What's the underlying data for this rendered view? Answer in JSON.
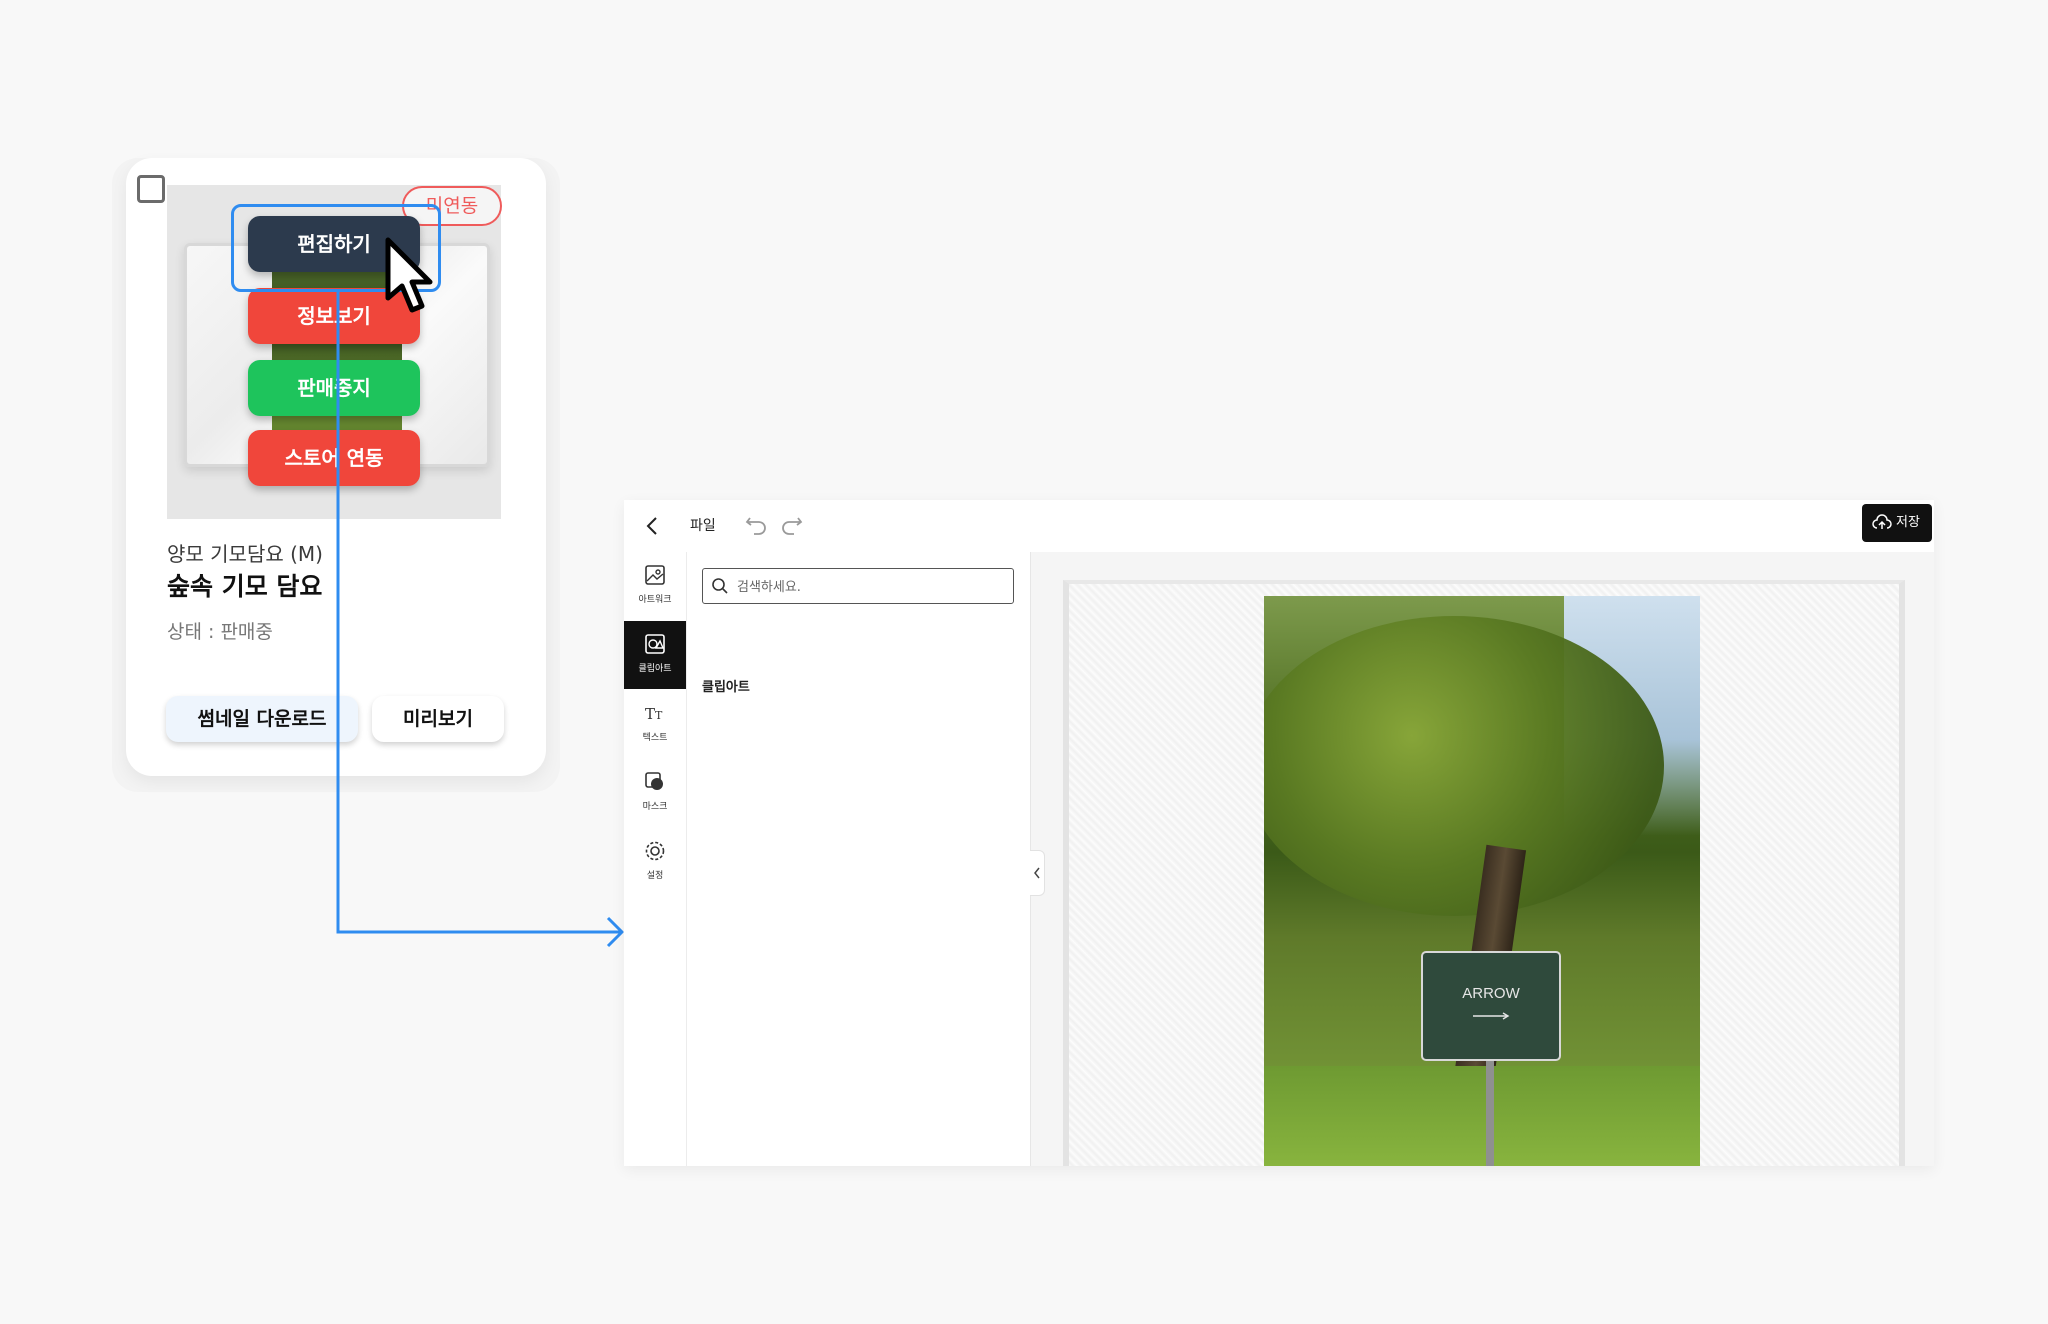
{
  "product_card": {
    "status_badge": "미연동",
    "menu": {
      "edit": "편집하기",
      "info": "정보보기",
      "stop_sale": "판매중지",
      "store_link": "스토어 연동"
    },
    "subtitle": "양모 기모담요 (M)",
    "title": "숲속 기모 담요",
    "status_label": "상태 : ",
    "status_value": "판매중",
    "buttons": {
      "thumbnail_download": "썸네일 다운로드",
      "preview": "미리보기"
    }
  },
  "editor": {
    "topbar": {
      "file_menu": "파일",
      "save": "저장"
    },
    "rail": [
      {
        "label": "아트워크",
        "icon": "image-icon"
      },
      {
        "label": "클립아트",
        "icon": "clipart-icon"
      },
      {
        "label": "텍스트",
        "icon": "text-icon"
      },
      {
        "label": "마스크",
        "icon": "mask-icon"
      },
      {
        "label": "설정",
        "icon": "gear-icon"
      }
    ],
    "search": {
      "placeholder": "검색하세요."
    },
    "panel_heading": "클립아트",
    "canvas": {
      "sign_text": "ARROW"
    }
  },
  "colors": {
    "edit_btn": "#2c3a4d",
    "info_btn": "#f0463b",
    "stop_btn": "#1ec45c",
    "highlight": "#2f8cf0",
    "badge": "#ef5b5b"
  }
}
